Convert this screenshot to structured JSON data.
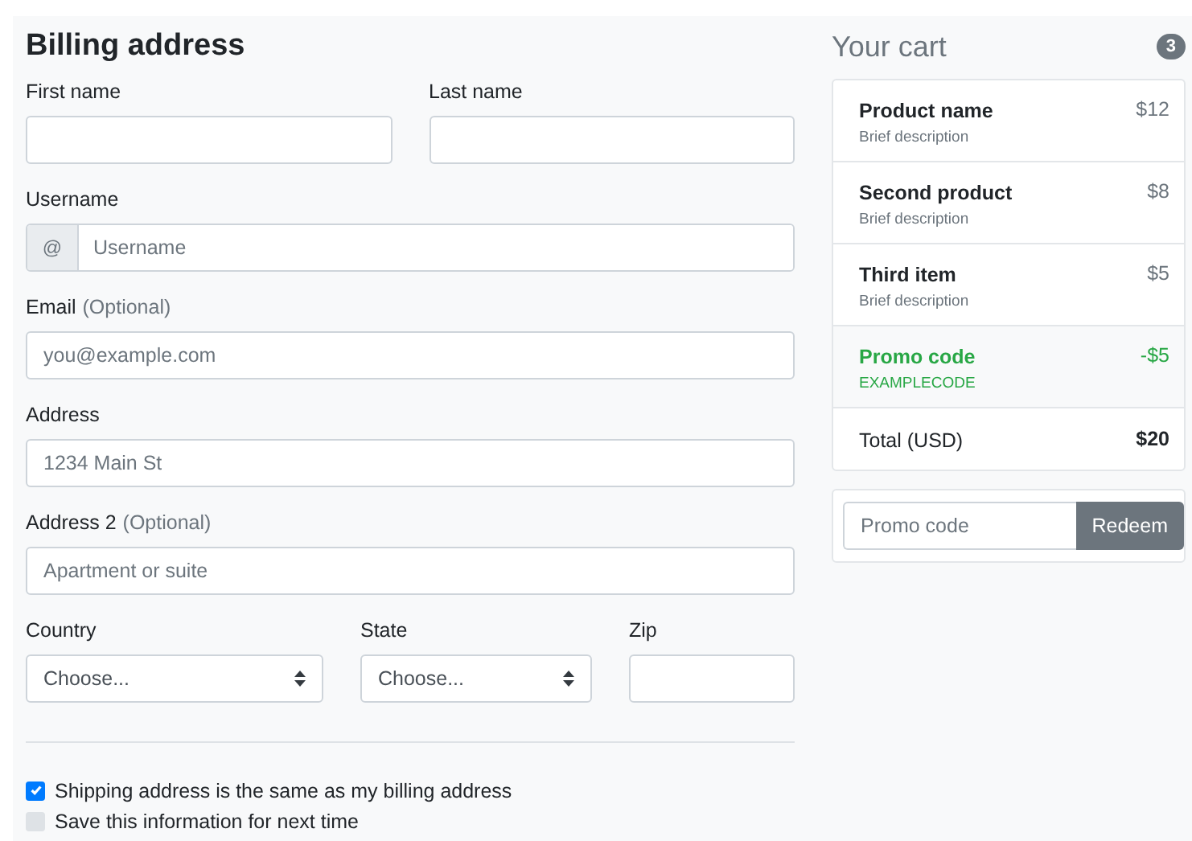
{
  "billing": {
    "title": "Billing address",
    "fields": [
      {
        "kind": "pair",
        "items": [
          {
            "label": "First name"
          },
          {
            "label": "Last name"
          }
        ]
      },
      {
        "kind": "prefixed",
        "label": "Username",
        "prefix": "@",
        "placeholder": "Username"
      },
      {
        "kind": "text",
        "label": "Email",
        "note": "(Optional)",
        "placeholder": "you@example.com"
      },
      {
        "kind": "text",
        "label": "Address",
        "placeholder": "1234 Main St"
      },
      {
        "kind": "text",
        "label": "Address 2",
        "note": "(Optional)",
        "placeholder": "Apartment or suite"
      }
    ],
    "selects": [
      {
        "kind": "select",
        "label": "Country",
        "value": "Choose..."
      },
      {
        "kind": "select",
        "label": "State",
        "value": "Choose..."
      },
      {
        "kind": "text",
        "label": "Zip"
      }
    ],
    "checkboxes": [
      {
        "label": "Shipping address is the same as my billing address",
        "checked": true
      },
      {
        "label": "Save this information for next time",
        "checked": false
      }
    ]
  },
  "cart": {
    "title": "Your cart",
    "count": "3",
    "items": [
      {
        "kind": "product",
        "name": "Product name",
        "description": "Brief description",
        "price": "$12"
      },
      {
        "kind": "product",
        "name": "Second product",
        "description": "Brief description",
        "price": "$8"
      },
      {
        "kind": "product",
        "name": "Third item",
        "description": "Brief description",
        "price": "$5"
      },
      {
        "kind": "promo",
        "name": "Promo code",
        "description": "EXAMPLECODE",
        "price": "-$5"
      },
      {
        "kind": "total",
        "name": "Total (USD)",
        "price": "$20"
      }
    ],
    "promo": {
      "placeholder": "Promo code",
      "button": "Redeem"
    }
  }
}
